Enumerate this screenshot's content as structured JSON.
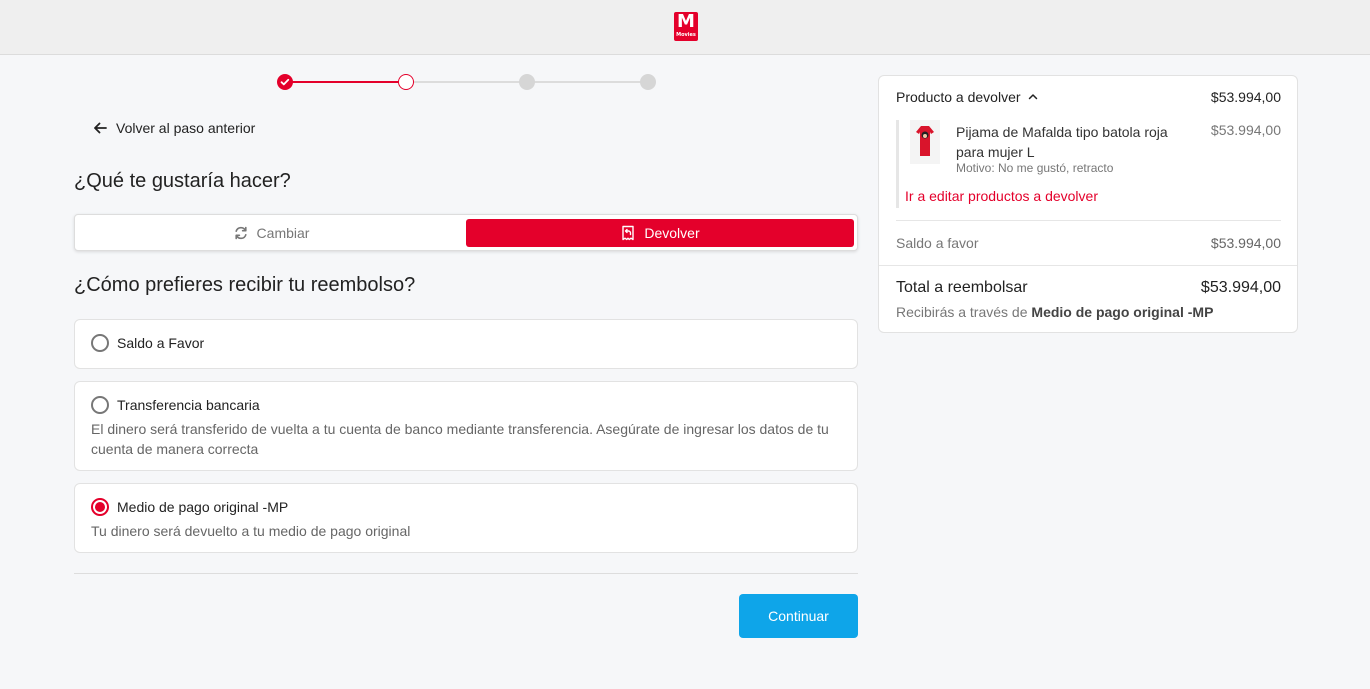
{
  "brand": {
    "logo_big": "M",
    "logo_small": "Movies",
    "accent": "#e4002b",
    "button_color": "#0ea5e9"
  },
  "stepper": {
    "steps_total": 4,
    "completed": 1,
    "current": 2
  },
  "nav": {
    "back_label": "Volver al paso anterior"
  },
  "question": {
    "title": "¿Qué te gustaría hacer?"
  },
  "action_toggle": {
    "exchange_label": "Cambiar",
    "return_label": "Devolver",
    "selected": "Devolver"
  },
  "refund": {
    "title": "¿Cómo prefieres recibir tu reembolso?",
    "options": [
      {
        "label": "Saldo a Favor",
        "selected": false,
        "description": ""
      },
      {
        "label": "Transferencia bancaria",
        "selected": false,
        "description": "El dinero será transferido de vuelta a tu cuenta de banco mediante transferencia. Asegúrate de ingresar los datos de tu cuenta de manera correcta"
      },
      {
        "label": "Medio de pago original -MP",
        "selected": true,
        "description": "Tu dinero será devuelto a tu medio de pago original"
      }
    ]
  },
  "actions": {
    "continue_label": "Continuar"
  },
  "summary": {
    "header_label": "Producto a devolver",
    "header_price": "$53.994,00",
    "product": {
      "name": "Pijama de Mafalda tipo batola roja para mujer L",
      "price": "$53.994,00",
      "reason": "Motivo: No me gustó, retracto"
    },
    "edit_link": "Ir a editar productos a devolver",
    "saldo_label": "Saldo a favor",
    "saldo_value": "$53.994,00",
    "total_label": "Total a reembolsar",
    "total_value": "$53.994,00",
    "via_prefix": "Recibirás a través de",
    "via_method": "Medio de pago original -MP"
  }
}
